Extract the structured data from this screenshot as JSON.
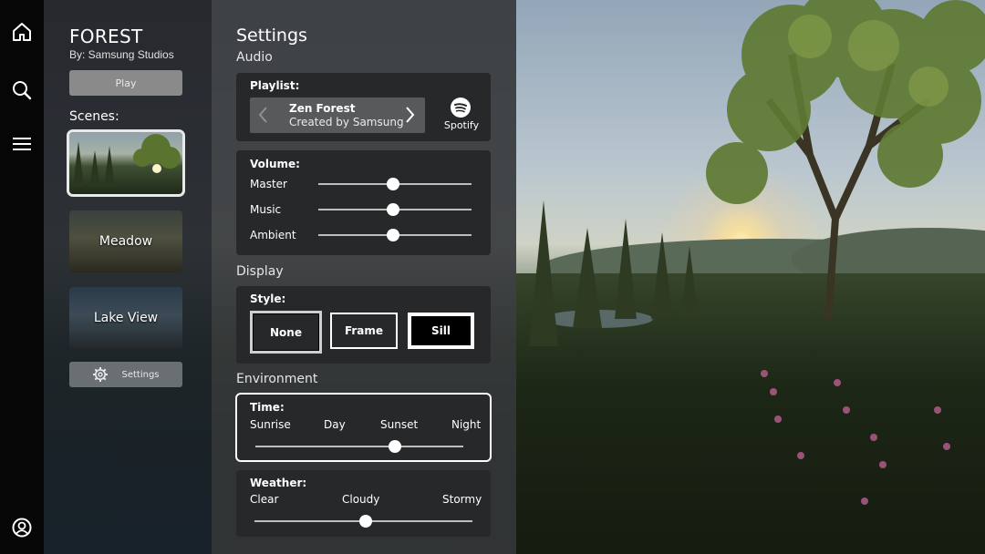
{
  "app": {
    "title": "FOREST",
    "byline": "By: Samsung Studios"
  },
  "left": {
    "play_label": "Play",
    "scenes_label": "Scenes:",
    "scenes": [
      {
        "label": "",
        "selected": true
      },
      {
        "label": "Meadow",
        "selected": false
      },
      {
        "label": "Lake View",
        "selected": false
      }
    ],
    "settings_label": "Settings"
  },
  "settings": {
    "title": "Settings",
    "audio": {
      "section": "Audio",
      "playlist_label": "Playlist:",
      "playlist_name": "Zen Forest",
      "playlist_sub": "Created by Samsung",
      "service": "Spotify",
      "volume_label": "Volume:",
      "sliders": [
        {
          "label": "Master",
          "value": 0.49
        },
        {
          "label": "Music",
          "value": 0.49
        },
        {
          "label": "Ambient",
          "value": 0.49
        }
      ]
    },
    "display": {
      "section": "Display",
      "style_label": "Style:",
      "options": [
        "None",
        "Frame",
        "Sill"
      ],
      "selected": "Sill"
    },
    "environment": {
      "section": "Environment",
      "time_label": "Time:",
      "time_options": [
        "Sunrise",
        "Day",
        "Sunset",
        "Night"
      ],
      "time_value": 0.67,
      "weather_label": "Weather:",
      "weather_options": [
        "Clear",
        "Cloudy",
        "Stormy"
      ],
      "weather_value": 0.51
    }
  },
  "icons": {
    "home": "home-icon",
    "search": "search-icon",
    "menu": "menu-icon",
    "account": "account-icon",
    "gear": "gear-icon",
    "spotify": "spotify-icon"
  }
}
